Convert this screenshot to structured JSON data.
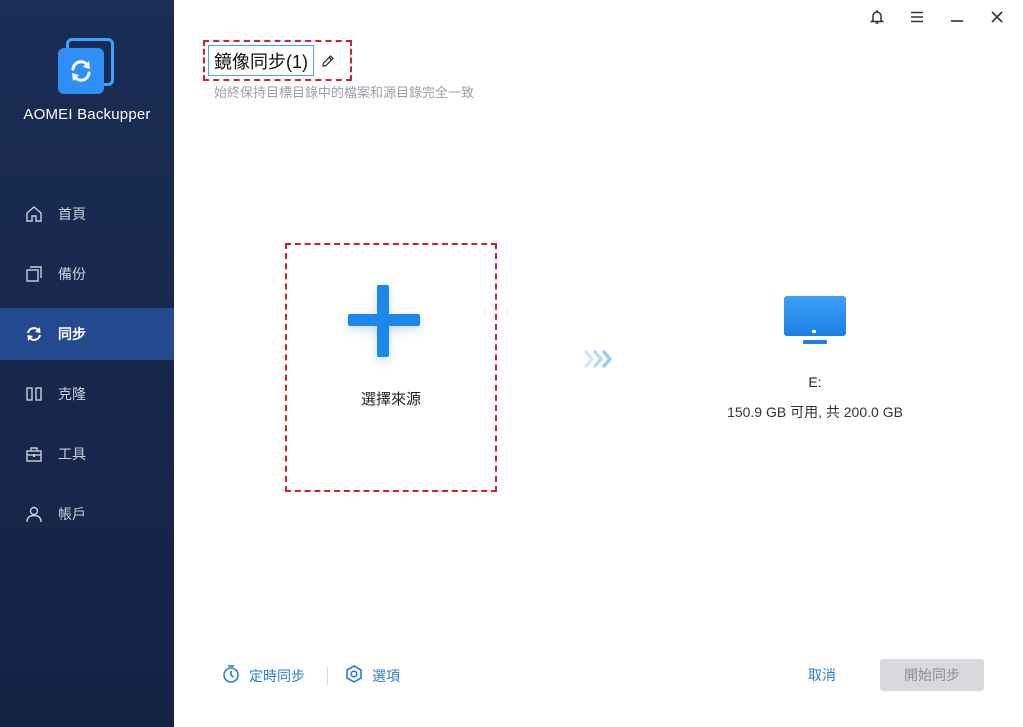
{
  "app": {
    "name": "AOMEI Backupper"
  },
  "colors": {
    "sidebar": "#1b2d55",
    "active": "#24498f",
    "accent": "#1f86ea",
    "danger": "#d4202c"
  },
  "sidebar": {
    "items": [
      {
        "label": "首頁",
        "icon": "home-icon",
        "active": false
      },
      {
        "label": "備份",
        "icon": "backup-icon",
        "active": false
      },
      {
        "label": "同步",
        "icon": "sync-icon",
        "active": true
      },
      {
        "label": "克隆",
        "icon": "clone-icon",
        "active": false
      },
      {
        "label": "工具",
        "icon": "tools-icon",
        "active": false
      },
      {
        "label": "帳戶",
        "icon": "account-icon",
        "active": false
      }
    ]
  },
  "window_controls": [
    "bell-icon",
    "menu-icon",
    "minimize-icon",
    "close-icon"
  ],
  "header": {
    "title": "鏡像同步(1)",
    "subtitle": "始終保持目標目錄中的檔案和源目錄完全一致"
  },
  "source": {
    "label": "選擇來源"
  },
  "destination": {
    "drive": "E:",
    "space": "150.9 GB 可用, 共 200.0 GB"
  },
  "footer": {
    "schedule_label": "定時同步",
    "options_label": "選項",
    "cancel_label": "取消",
    "start_label": "開始同步"
  }
}
